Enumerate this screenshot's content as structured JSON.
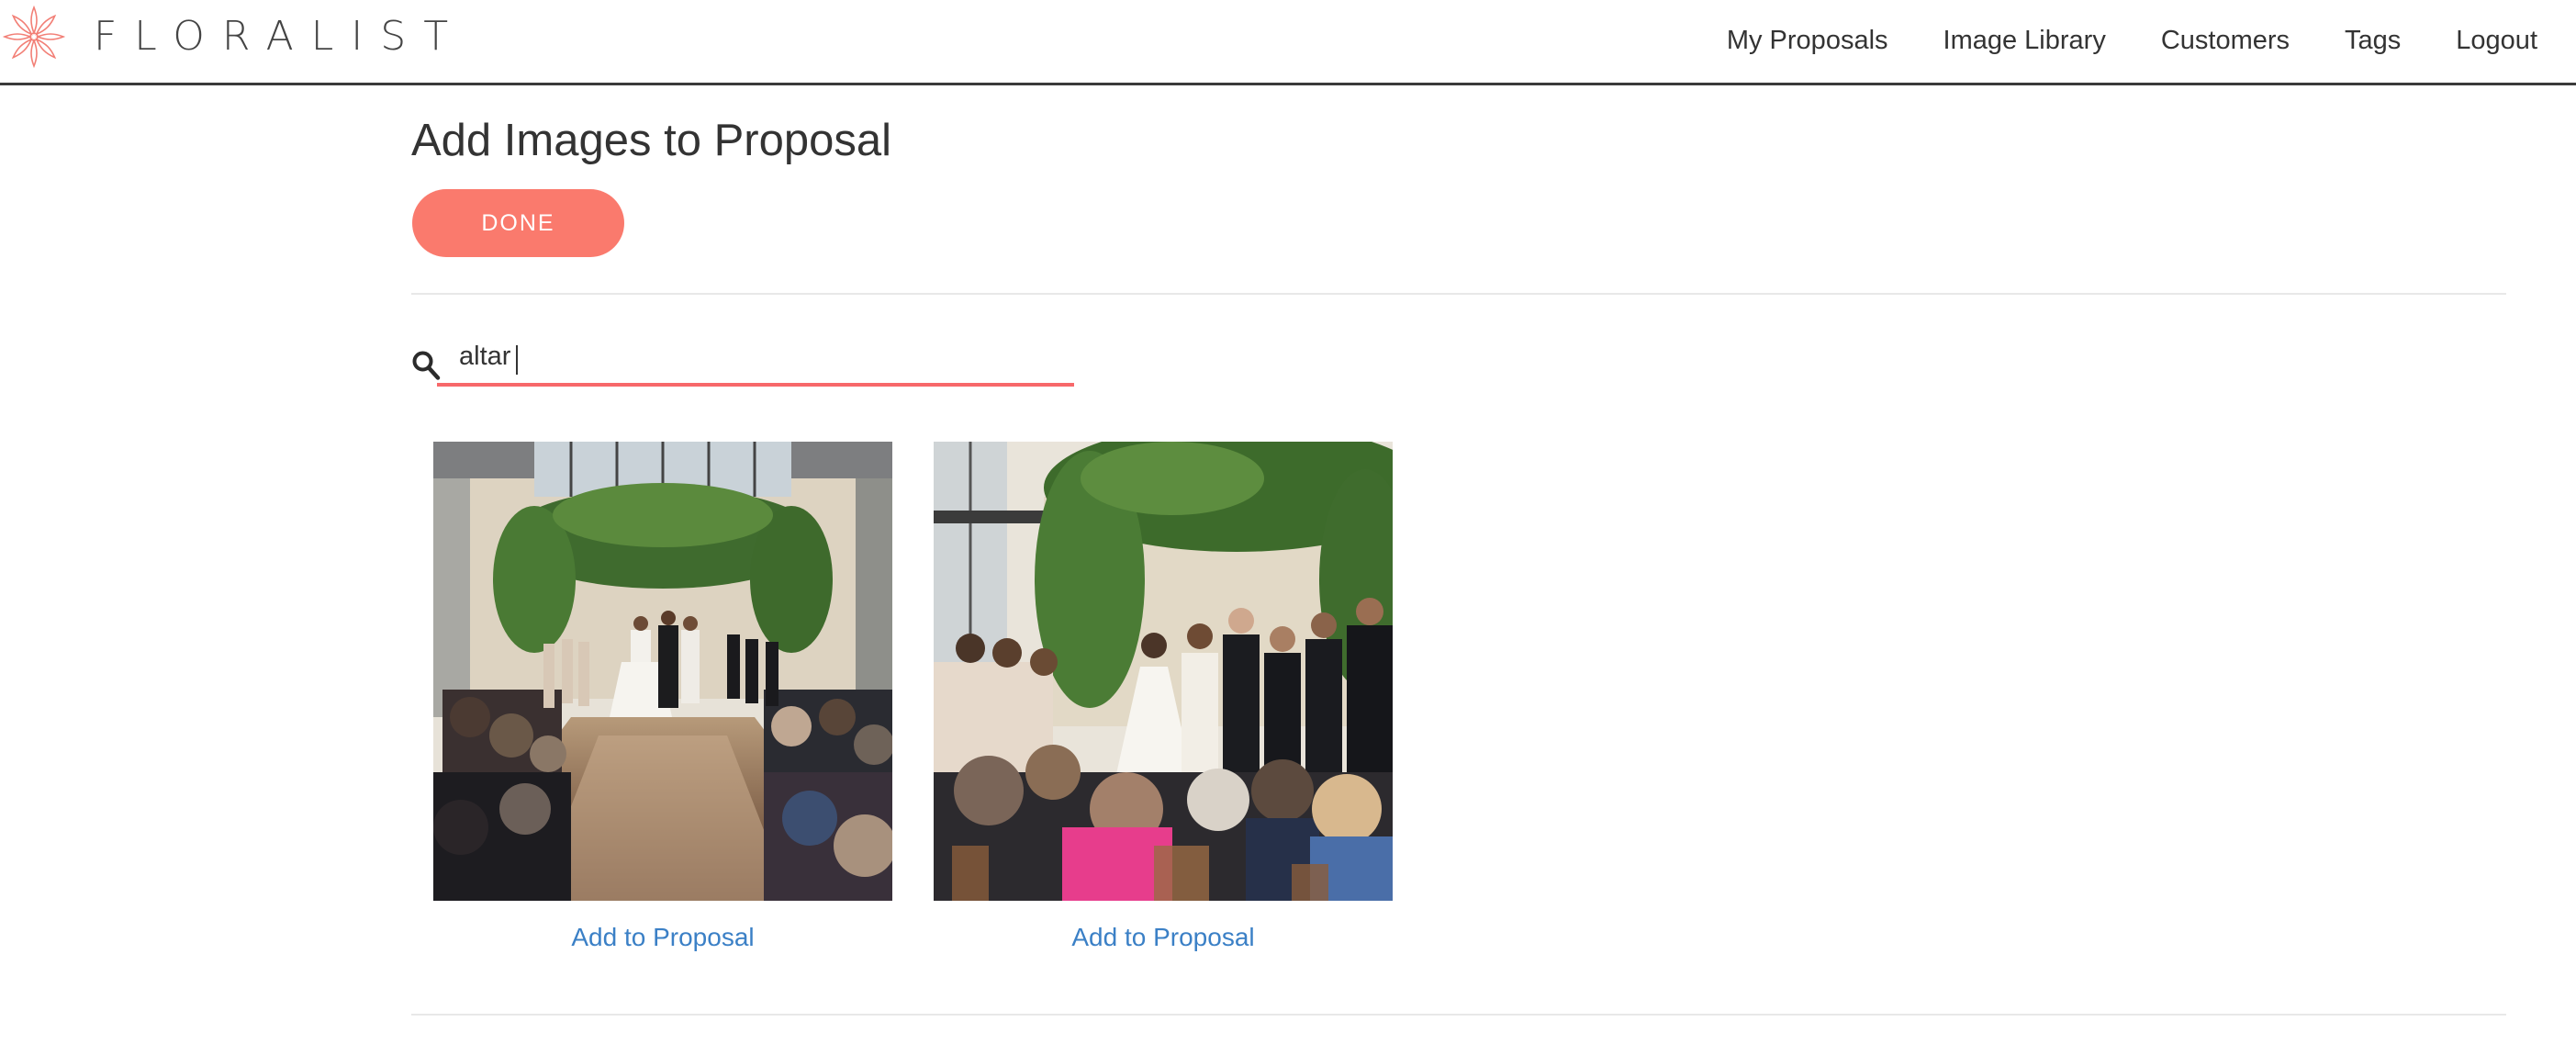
{
  "brand": {
    "name": "FLORALIST",
    "logo_icon": "flower-icon",
    "accent_color": "#fa7a6d"
  },
  "nav": {
    "items": [
      {
        "label": "My Proposals"
      },
      {
        "label": "Image Library"
      },
      {
        "label": "Customers"
      },
      {
        "label": "Tags"
      },
      {
        "label": "Logout"
      }
    ]
  },
  "page": {
    "title": "Add Images to Proposal",
    "done_label": "DONE"
  },
  "search": {
    "icon": "search-icon",
    "value": "altar",
    "underline_color": "#f7686a"
  },
  "results": [
    {
      "image_description": "wedding-ceremony-greenery-arch-aisle",
      "action_label": "Add to Proposal"
    },
    {
      "image_description": "wedding-ceremony-altar-close",
      "action_label": "Add to Proposal"
    }
  ],
  "colors": {
    "link": "#3b80c6",
    "text": "#333333"
  }
}
